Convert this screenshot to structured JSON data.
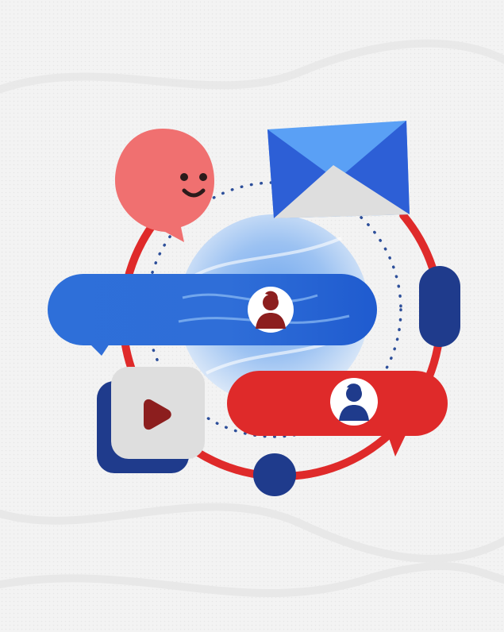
{
  "palette": {
    "background": "#f3f3f3",
    "ring_red": "#df2a2a",
    "bubble_pink": "#f07070",
    "face": "#2b1b1b",
    "envelope_light": "#5aa0f5",
    "envelope_dark": "#2d5fd6",
    "envelope_flap": "#dedede",
    "bar_blue": "#2f6ed8",
    "avatar_dark_red": "#8c1e1e",
    "navy": "#1f3b8c",
    "tile_gray": "#dedede",
    "dotted_blue": "#2d4f9a"
  },
  "icons": [
    "smiley-chat-bubble-icon",
    "envelope-icon",
    "person-avatar-icon",
    "play-icon",
    "headset-icon"
  ]
}
